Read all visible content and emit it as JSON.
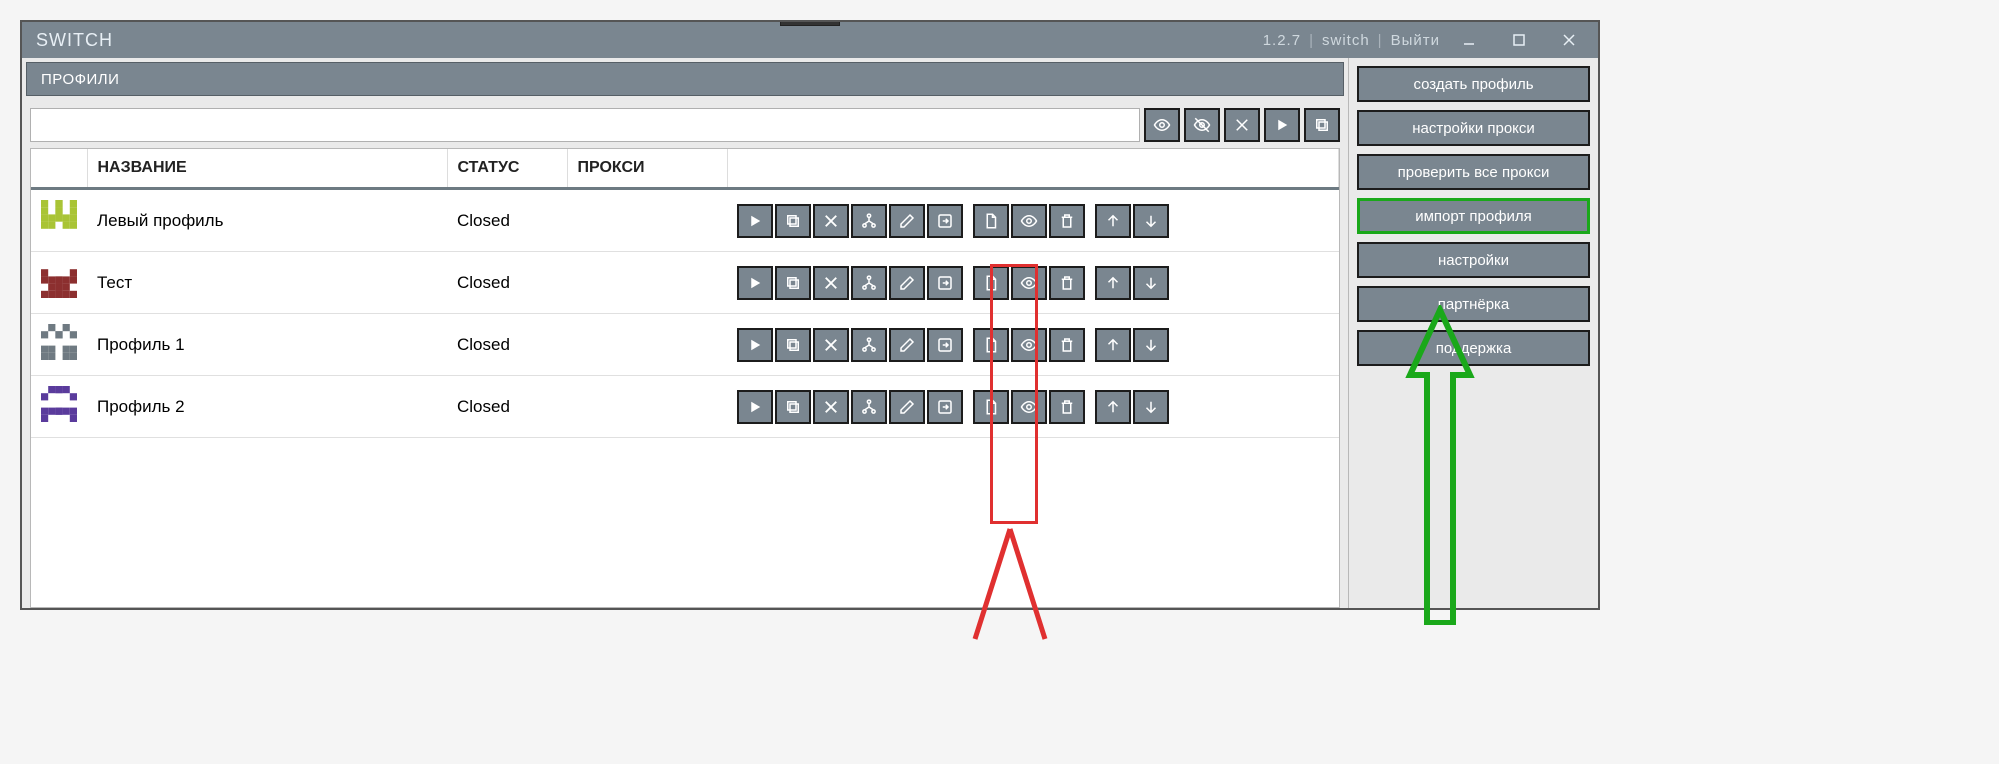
{
  "titlebar": {
    "app_name": "SWITCH",
    "version": "1.2.7",
    "user": "switch",
    "logout": "Выйти"
  },
  "section_header": "ПРОФИЛИ",
  "search": {
    "placeholder": ""
  },
  "table": {
    "headers": {
      "name": "НАЗВАНИЕ",
      "status": "СТАТУС",
      "proxy": "ПРОКСИ"
    },
    "rows": [
      {
        "name": "Левый профиль",
        "status": "Closed",
        "proxy": "",
        "avatar_color": "#a9c435"
      },
      {
        "name": "Тест",
        "status": "Closed",
        "proxy": "",
        "avatar_color": "#8c2f2f"
      },
      {
        "name": "Профиль 1",
        "status": "Closed",
        "proxy": "",
        "avatar_color": "#6f7a82"
      },
      {
        "name": "Профиль 2",
        "status": "Closed",
        "proxy": "",
        "avatar_color": "#5a3b9c"
      }
    ]
  },
  "sidebar": {
    "buttons": [
      {
        "label": "создать профиль",
        "highlight": false
      },
      {
        "label": "настройки прокси",
        "highlight": false
      },
      {
        "label": "проверить все прокси",
        "highlight": false
      },
      {
        "label": "импорт профиля",
        "highlight": true
      },
      {
        "label": "настройки",
        "highlight": false
      },
      {
        "label": "партнёрка",
        "highlight": false
      },
      {
        "label": "поддержка",
        "highlight": false
      }
    ]
  }
}
